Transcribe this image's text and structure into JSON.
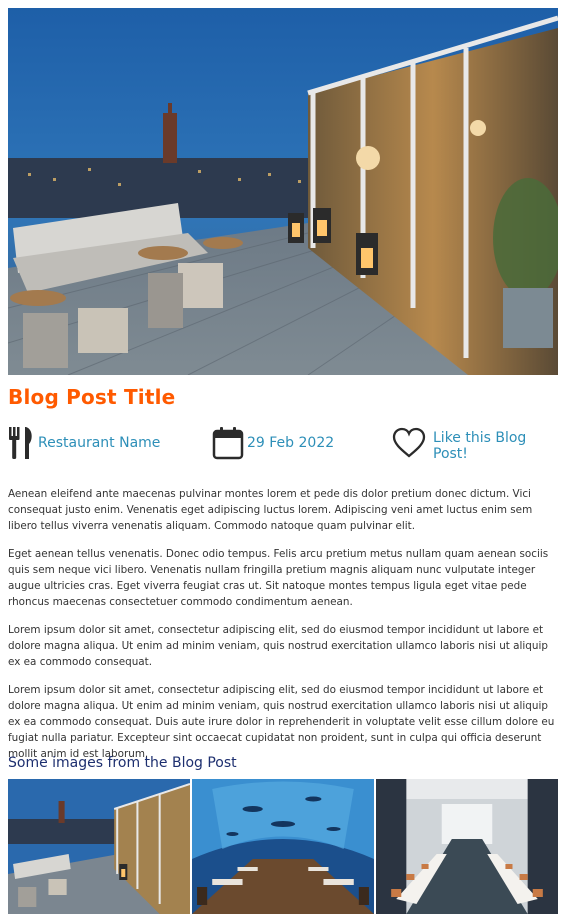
{
  "post": {
    "title": "Blog Post Title",
    "restaurant": "Restaurant Name",
    "date": "29 Feb 2022",
    "like": "Like this Blog Post!"
  },
  "icons": {
    "restaurant": "fork-knife-icon",
    "date": "calendar-icon",
    "like": "heart-icon"
  },
  "body": {
    "p1": "Aenean eleifend ante maecenas pulvinar montes lorem et pede dis dolor pretium donec dictum. Vici consequat justo enim. Venenatis eget adipiscing luctus lorem. Adipiscing veni amet luctus enim sem libero tellus viverra venenatis aliquam. Commodo natoque quam pulvinar elit.",
    "p2": "Eget aenean tellus venenatis. Donec odio tempus. Felis arcu pretium metus nullam quam aenean sociis quis sem neque vici libero. Venenatis nullam fringilla pretium magnis aliquam nunc vulputate integer augue ultricies cras. Eget viverra feugiat cras ut. Sit natoque montes tempus ligula eget vitae pede rhoncus maecenas consectetuer commodo condimentum aenean.",
    "p3": "Lorem ipsum dolor sit amet, consectetur adipiscing elit, sed do eiusmod tempor incididunt ut labore et dolore magna aliqua. Ut enim ad minim veniam, quis nostrud exercitation ullamco laboris nisi ut aliquip ex ea commodo consequat.",
    "p4": "Lorem ipsum dolor sit amet, consectetur adipiscing elit, sed do eiusmod tempor incididunt ut labore et dolore magna aliqua. Ut enim ad minim veniam, quis nostrud exercitation ullamco laboris nisi ut aliquip ex ea commodo consequat. Duis aute irure dolor in reprehenderit in voluptate velit esse cillum dolore eu fugiat nulla pariatur. Excepteur sint occaecat cupidatat non proident, sunt in culpa qui officia deserunt mollit anim id est laborum."
  },
  "gallery": {
    "heading": "Some images from the Blog Post"
  },
  "colors": {
    "title": "#ff5a00",
    "meta": "#2d8fb8",
    "subtitle": "#1d2f6f"
  }
}
